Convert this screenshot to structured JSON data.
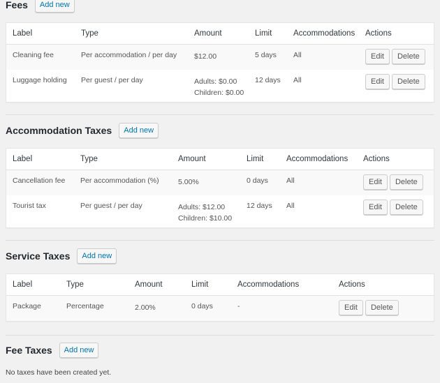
{
  "columns": {
    "label": "Label",
    "type": "Type",
    "amount": "Amount",
    "limit": "Limit",
    "accommodations": "Accommodations",
    "actions": "Actions"
  },
  "buttons": {
    "add_new": "Add new",
    "edit": "Edit",
    "delete": "Delete"
  },
  "fees": {
    "title": "Fees",
    "rows": [
      {
        "label": "Cleaning fee",
        "type": "Per accommodation / per day",
        "amount": [
          "$12.00"
        ],
        "limit": "5 days",
        "accommodations": "All"
      },
      {
        "label": "Luggage holding",
        "type": "Per guest / per day",
        "amount": [
          "Adults: $0.00",
          "Children: $0.00"
        ],
        "limit": "12 days",
        "accommodations": "All"
      }
    ]
  },
  "accommodation_taxes": {
    "title": "Accommodation Taxes",
    "rows": [
      {
        "label": "Cancellation fee",
        "type": "Per accommodation (%)",
        "amount": [
          "5.00%"
        ],
        "limit": "0 days",
        "accommodations": "All"
      },
      {
        "label": "Tourist tax",
        "type": "Per guest / per day",
        "amount": [
          "Adults: $12.00",
          "Children: $10.00"
        ],
        "limit": "12 days",
        "accommodations": "All"
      }
    ]
  },
  "service_taxes": {
    "title": "Service Taxes",
    "rows": [
      {
        "label": "Package",
        "type": "Percentage",
        "amount": [
          "2.00%"
        ],
        "limit": "0 days",
        "accommodations": "-"
      }
    ]
  },
  "fee_taxes": {
    "title": "Fee Taxes",
    "empty_message": "No taxes have been created yet."
  }
}
